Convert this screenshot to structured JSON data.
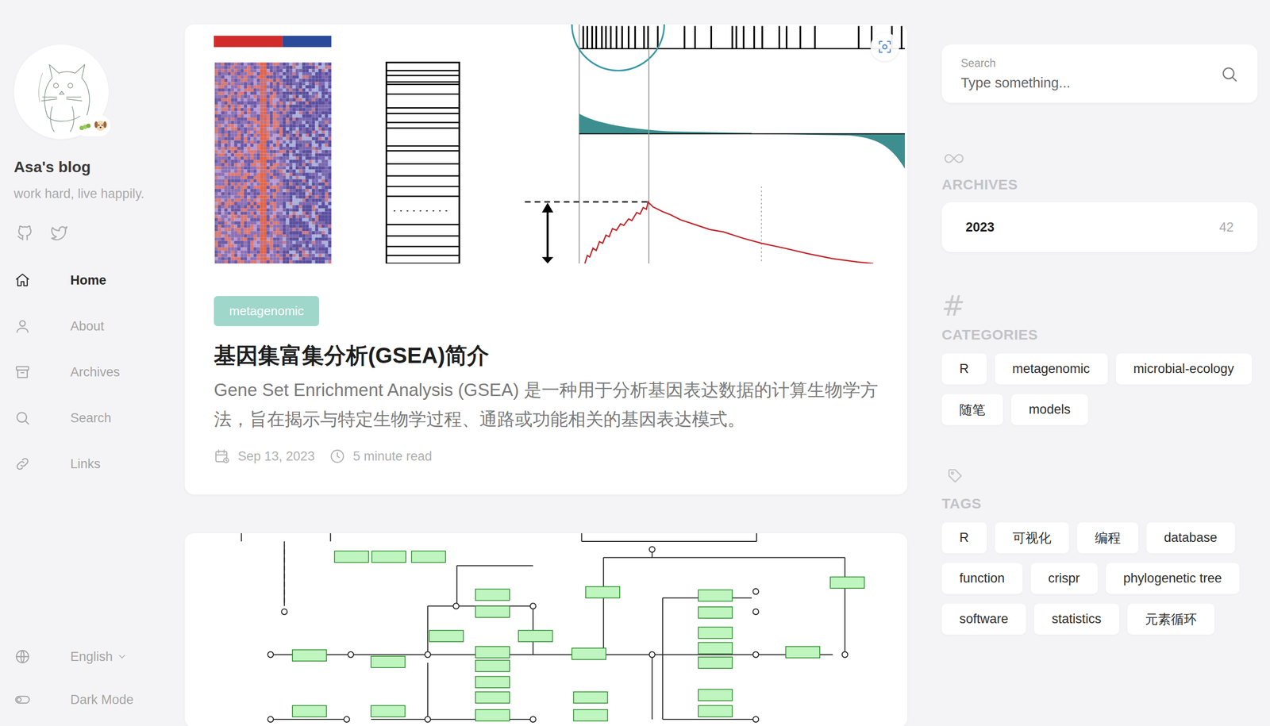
{
  "profile": {
    "name": "Asa's blog",
    "tagline": "work hard, live happily."
  },
  "nav": [
    {
      "label": "Home",
      "selected": true
    },
    {
      "label": "About",
      "selected": false
    },
    {
      "label": "Archives",
      "selected": false
    },
    {
      "label": "Search",
      "selected": false
    },
    {
      "label": "Links",
      "selected": false
    }
  ],
  "language": {
    "label": "English"
  },
  "theme_toggle": {
    "label": "Dark Mode",
    "on": false
  },
  "posts": [
    {
      "category": "metagenomic",
      "title": "基因集富集分析(GSEA)简介",
      "excerpt": "Gene Set Enrichment Analysis (GSEA) 是一种用于分析基因表达数据的计算生物学方法，旨在揭示与特定生物学过程、通路或功能相关的基因表达模式。",
      "date": "Sep 13, 2023",
      "read_time": "5 minute read"
    }
  ],
  "search": {
    "label": "Search",
    "placeholder": "Type something..."
  },
  "archives": {
    "heading": "ARCHIVES",
    "items": [
      {
        "year": "2023",
        "count": "42"
      }
    ]
  },
  "categories": {
    "icon": "#",
    "heading": "CATEGORIES",
    "items": [
      "R",
      "metagenomic",
      "microbial-ecology",
      "随笔",
      "models"
    ]
  },
  "tags": {
    "heading": "TAGS",
    "items": [
      "R",
      "可视化",
      "编程",
      "database",
      "function",
      "crispr",
      "phylogenetic tree",
      "software",
      "statistics",
      "元素循环"
    ]
  }
}
